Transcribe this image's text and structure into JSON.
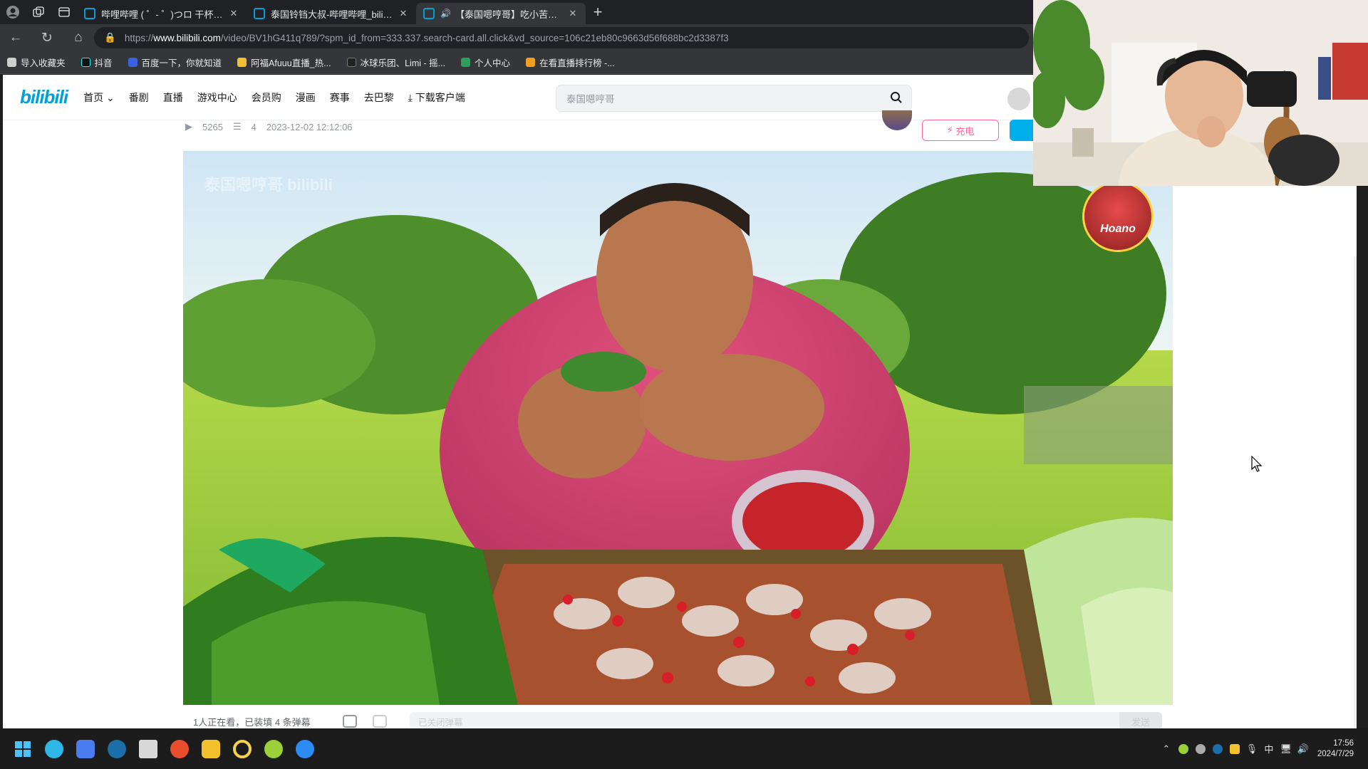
{
  "tabs": [
    {
      "title": "哔哩哔哩 ( ゜- ゜)つロ 干杯~-bilibili",
      "active": false
    },
    {
      "title": "泰国铃铛大叔-哔哩哔哩_bilibili",
      "active": false
    },
    {
      "title": "【泰国嗯哼哥】吃小苦瓜蘸",
      "active": true
    }
  ],
  "address": {
    "scheme": "https://",
    "host": "www.bilibili.com",
    "path": "/video/BV1hG411q789/?spm_id_from=333.337.search-card.all.click&vd_source=106c21eb80c9663d56f688bc2d3387f3"
  },
  "bookmarks": [
    {
      "label": "导入收藏夹",
      "color": "#cfcfcf"
    },
    {
      "label": "抖音",
      "color": "#111111"
    },
    {
      "label": "百度一下，你就知道",
      "color": "#3a62e0"
    },
    {
      "label": "阿福Afuuu直播_热...",
      "color": "#f0c030"
    },
    {
      "label": "冰球乐团、Limi - 摇...",
      "color": "#222222"
    },
    {
      "label": "个人中心",
      "color": "#2f9e5a"
    },
    {
      "label": "在看直播排行榜 -...",
      "color": "#f0a020"
    }
  ],
  "site": {
    "logo": "bilibili",
    "nav": [
      "首页 ⌄",
      "番剧",
      "直播",
      "游戏中心",
      "会员购",
      "漫画",
      "赛事",
      "去巴黎",
      "下载客户端"
    ],
    "search_placeholder": "泰国嗯哼哥"
  },
  "video": {
    "plays": "5265",
    "danmaku_count": "4",
    "date": "2023-12-02 12:12:06",
    "charge_label": "充电",
    "watermark": "泰国嗯哼哥   bilibili",
    "badge_text": "Hoano"
  },
  "danmaku": {
    "live_text": "1人正在看，已装填 4 条弹幕",
    "input_placeholder": "已关闭弹幕",
    "send_label": "发送"
  },
  "taskbar": {
    "apps": [
      {
        "name": "start",
        "color": "#4cc2ff"
      },
      {
        "name": "edge",
        "color": "#2fb7e8"
      },
      {
        "name": "kook",
        "color": "#4a7cf0"
      },
      {
        "name": "steam",
        "color": "#1b6fa8"
      },
      {
        "name": "pinned-app",
        "color": "#d8d8d8"
      },
      {
        "name": "gaming-app",
        "color": "#e84e2c"
      },
      {
        "name": "owl-app",
        "color": "#f3c12c"
      },
      {
        "name": "circle-app",
        "color": "#f4d34a"
      },
      {
        "name": "ball-app",
        "color": "#9ad13a"
      },
      {
        "name": "blue-app",
        "color": "#2c8cf4"
      }
    ],
    "ime": "中",
    "time": "17:56",
    "date": "2024/7/29"
  }
}
